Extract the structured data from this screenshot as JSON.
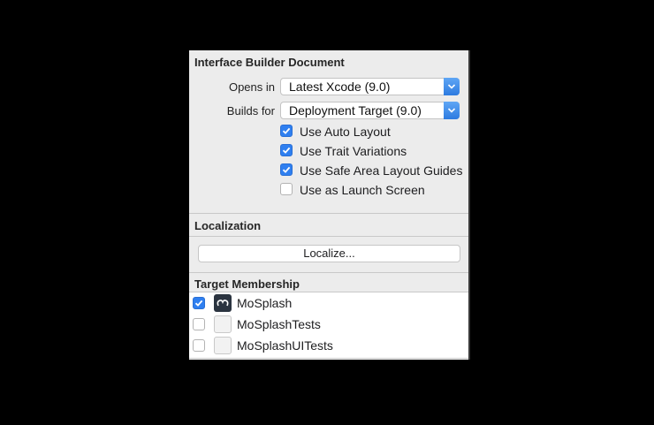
{
  "document": {
    "header": "Interface Builder Document",
    "opens_in": {
      "label": "Opens in",
      "value": "Latest Xcode (9.0)"
    },
    "builds_for": {
      "label": "Builds for",
      "value": "Deployment Target (9.0)"
    },
    "options": [
      {
        "label": "Use Auto Layout",
        "checked": true
      },
      {
        "label": "Use Trait Variations",
        "checked": true
      },
      {
        "label": "Use Safe Area Layout Guides",
        "checked": true
      },
      {
        "label": "Use as Launch Screen",
        "checked": false
      }
    ]
  },
  "localization": {
    "header": "Localization",
    "button_label": "Localize..."
  },
  "target_membership": {
    "header": "Target Membership",
    "targets": [
      {
        "label": "MoSplash",
        "checked": true,
        "icon": "app-target-icon"
      },
      {
        "label": "MoSplashTests",
        "checked": false,
        "icon": "test-target-icon"
      },
      {
        "label": "MoSplashUITests",
        "checked": false,
        "icon": "test-target-icon"
      }
    ]
  },
  "colors": {
    "accent": "#2f7ff0",
    "panel": "#ececec"
  }
}
